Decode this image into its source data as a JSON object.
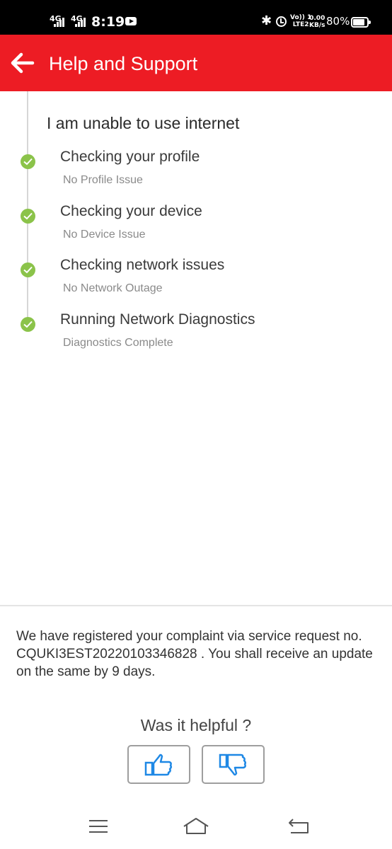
{
  "status_bar": {
    "sim1": "4G",
    "sim2": "4G",
    "time": "8:19",
    "volte_top": "Vo)) 1",
    "volte_bottom": "LTE2",
    "speed_value": "0.00",
    "speed_unit": "KB/s",
    "battery": "80%",
    "icons": [
      "signal-icon",
      "youtube-icon",
      "bluetooth-icon",
      "alarm-icon",
      "battery-icon"
    ]
  },
  "header": {
    "title": "Help and Support",
    "back_icon": "arrow-left-icon",
    "background": "#ed1c24"
  },
  "diagnosis": {
    "title": "I am unable to use internet",
    "steps": [
      {
        "title": "Checking your profile",
        "status": "No Profile Issue"
      },
      {
        "title": "Checking your device",
        "status": "No Device Issue"
      },
      {
        "title": "Checking network issues",
        "status": "No Network Outage"
      },
      {
        "title": "Running Network Diagnostics",
        "status": "Diagnostics Complete"
      }
    ],
    "check_color": "#8bc34a"
  },
  "feedback": {
    "message": "We have registered your complaint via service request no. CQUKI3EST20220103346828 . You shall receive an update on the same by 9 days.",
    "question": "Was it helpful ?",
    "thumbs_up_icon": "thumbs-up-icon",
    "thumbs_down_icon": "thumbs-down-icon",
    "icon_color": "#1e88e5"
  },
  "nav_bar": {
    "icons": [
      "menu-icon",
      "home-icon",
      "back-icon"
    ]
  }
}
